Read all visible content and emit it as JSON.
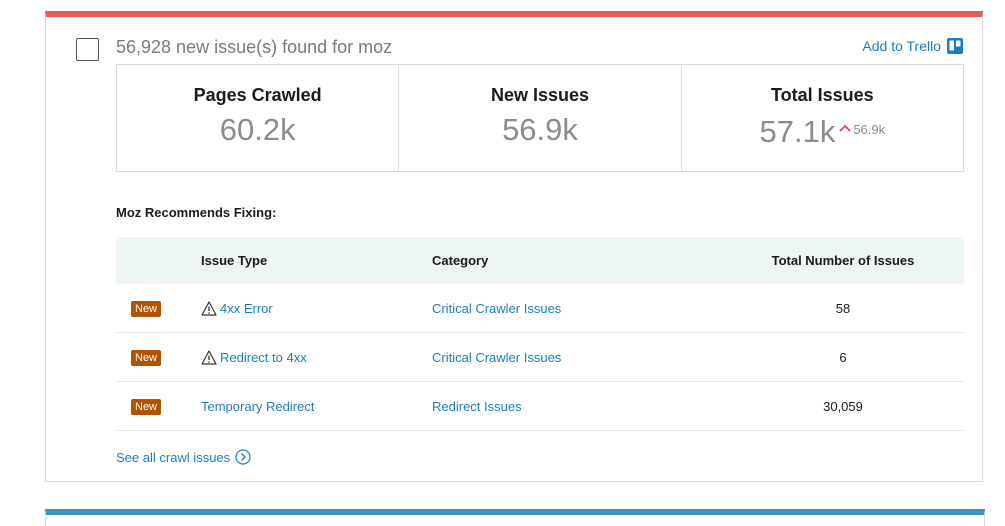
{
  "card": {
    "title": "56,928 new issue(s) found for moz",
    "add_to_trello_label": "Add to Trello",
    "accent_color": "#ea5a5a"
  },
  "stats": [
    {
      "label": "Pages Crawled",
      "value": "60.2k"
    },
    {
      "label": "New Issues",
      "value": "56.9k"
    },
    {
      "label": "Total Issues",
      "value": "57.1k",
      "delta": "56.9k",
      "delta_direction": "up"
    }
  ],
  "recommend": {
    "title": "Moz Recommends Fixing:",
    "columns": [
      "Issue Type",
      "Category",
      "Total Number of Issues"
    ],
    "rows": [
      {
        "badge": "New",
        "issue_type": "4xx Error",
        "warning": true,
        "category": "Critical Crawler Issues",
        "total": "58"
      },
      {
        "badge": "New",
        "issue_type": "Redirect to 4xx",
        "warning": true,
        "category": "Critical Crawler Issues",
        "total": "6"
      },
      {
        "badge": "New",
        "issue_type": "Temporary Redirect",
        "warning": false,
        "category": "Redirect Issues",
        "total": "30,059"
      }
    ]
  },
  "see_all_label": "See all crawl issues",
  "colors": {
    "link": "#1b7fbf",
    "badge": "#b35200",
    "next_card_accent": "#3d94bf"
  }
}
